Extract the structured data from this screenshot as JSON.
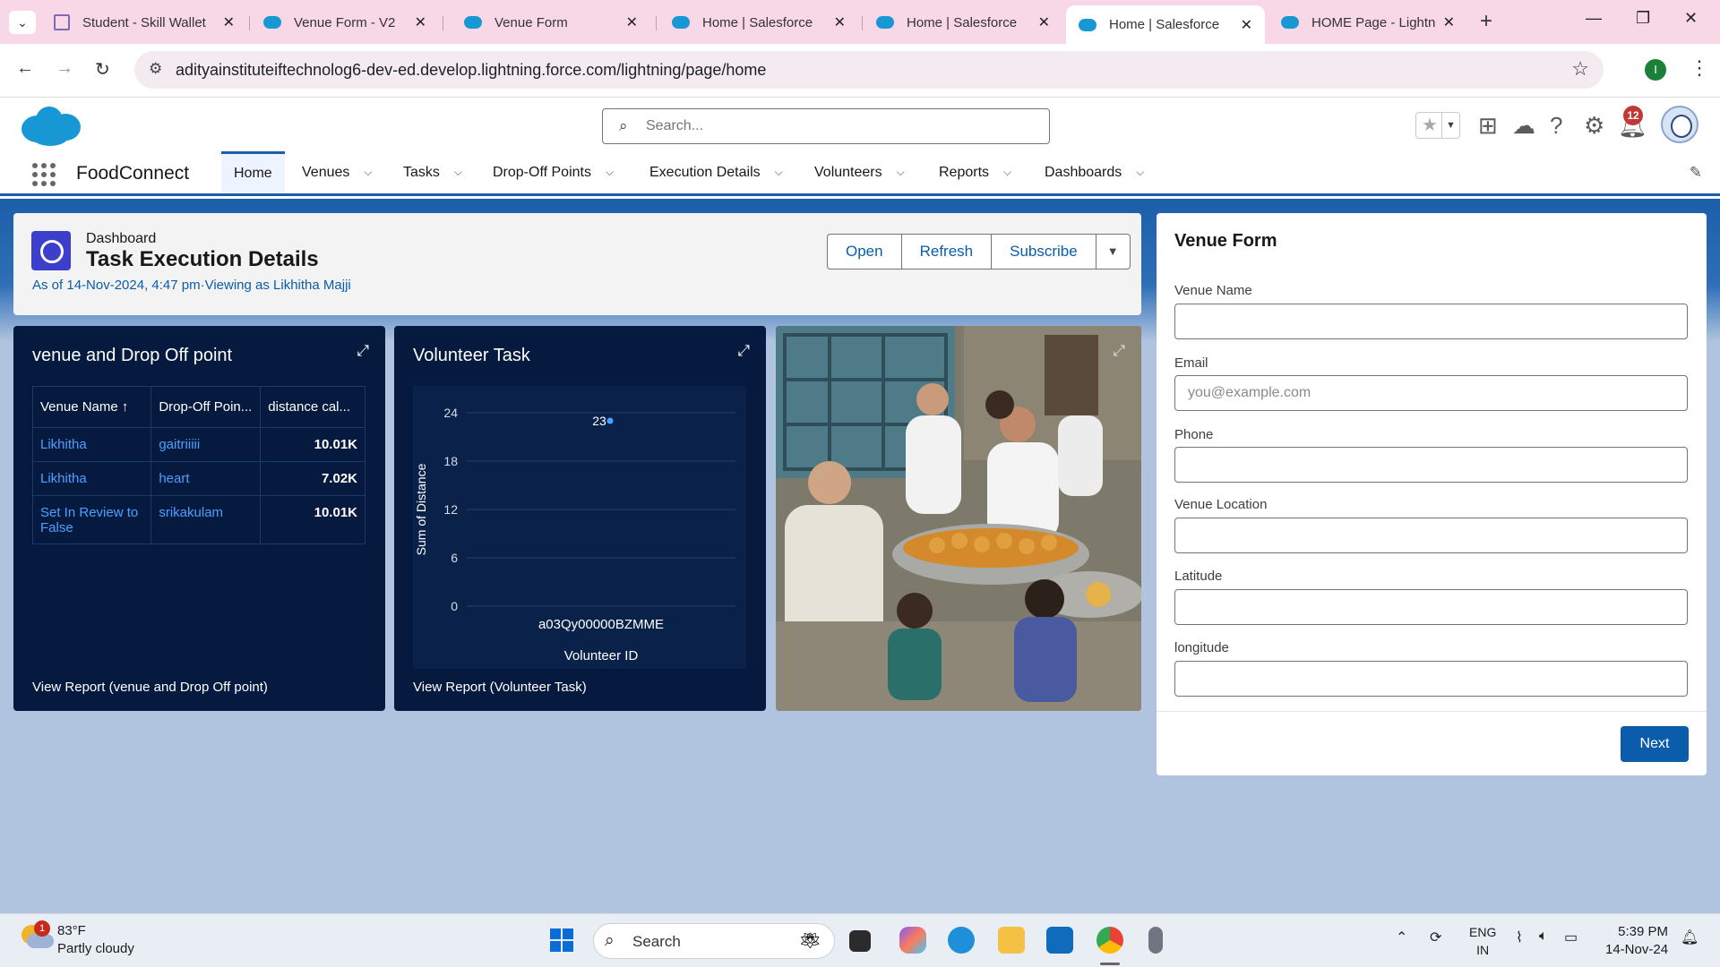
{
  "browser": {
    "tabs": [
      {
        "title": "Student - Skill Wallet",
        "active": false
      },
      {
        "title": "Venue Form - V2",
        "active": false
      },
      {
        "title": "Venue Form",
        "active": false
      },
      {
        "title": "Home | Salesforce",
        "active": false
      },
      {
        "title": "Home | Salesforce",
        "active": false
      },
      {
        "title": "Home | Salesforce",
        "active": true
      },
      {
        "title": "HOME Page - Lightni",
        "active": false
      }
    ],
    "url": "adityainstituteiftechnolog6-dev-ed.develop.lightning.force.com/lightning/page/home",
    "profile_initial": "I"
  },
  "sf": {
    "search_placeholder": "Search...",
    "notification_count": "12",
    "app_name": "FoodConnect",
    "nav": [
      {
        "label": "Home",
        "active": true,
        "has_menu": false
      },
      {
        "label": "Venues",
        "has_menu": true
      },
      {
        "label": "Tasks",
        "has_menu": true
      },
      {
        "label": "Drop-Off Points",
        "has_menu": true
      },
      {
        "label": "Execution Details",
        "has_menu": true
      },
      {
        "label": "Volunteers",
        "has_menu": true
      },
      {
        "label": "Reports",
        "has_menu": true
      },
      {
        "label": "Dashboards",
        "has_menu": true
      }
    ]
  },
  "dashboard": {
    "subtitle": "Dashboard",
    "title": "Task Execution Details",
    "meta": "As of 14-Nov-2024, 4:47 pm·Viewing as Likhitha Majji",
    "buttons": {
      "open": "Open",
      "refresh": "Refresh",
      "subscribe": "Subscribe"
    }
  },
  "widget1": {
    "title": "venue and Drop Off point",
    "columns": [
      "Venue Name ↑",
      "Drop-Off Poin...",
      "distance cal..."
    ],
    "rows": [
      [
        "Likhitha",
        "gaitriiiii",
        "10.01K"
      ],
      [
        "Likhitha",
        "heart",
        "7.02K"
      ],
      [
        "Set In Review to False",
        "srikakulam",
        "10.01K"
      ]
    ],
    "footer": "View Report (venue and Drop Off point)"
  },
  "widget2": {
    "title": "Volunteer Task",
    "footer": "View Report (Volunteer Task)"
  },
  "chart_data": {
    "type": "scatter",
    "title": "Volunteer Task",
    "xlabel": "Volunteer ID",
    "ylabel": "Sum of Distance",
    "categories": [
      "a03Qy00000BZMME"
    ],
    "values": [
      23
    ],
    "data_labels": [
      "23"
    ],
    "y_ticks": [
      "0",
      "6",
      "12",
      "18",
      "24"
    ],
    "ylim": [
      0,
      24
    ],
    "grid": true,
    "color": "#4ba0ff"
  },
  "form": {
    "title": "Venue Form",
    "fields": [
      {
        "label": "Venue Name",
        "value": "",
        "placeholder": ""
      },
      {
        "label": "Email",
        "value": "",
        "placeholder": "you@example.com"
      },
      {
        "label": "Phone",
        "value": "",
        "placeholder": ""
      },
      {
        "label": "Venue Location",
        "value": "",
        "placeholder": ""
      },
      {
        "label": "Latitude",
        "value": "",
        "placeholder": ""
      },
      {
        "label": "longitude",
        "value": "",
        "placeholder": ""
      }
    ],
    "next_label": "Next"
  },
  "taskbar": {
    "weather_badge": "1",
    "temp": "83°F",
    "weather": "Partly cloudy",
    "search_label": "Search",
    "lang1": "ENG",
    "lang2": "IN",
    "time": "5:39 PM",
    "date": "14-Nov-24"
  }
}
